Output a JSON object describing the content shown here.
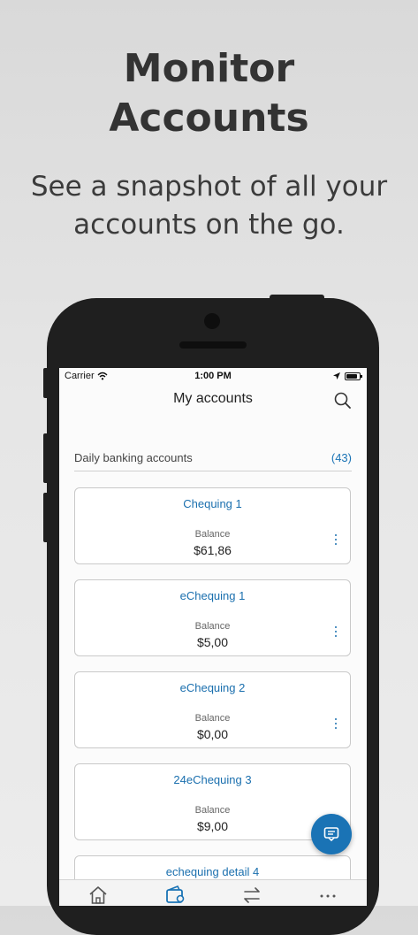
{
  "headline": {
    "title_line1": "Monitor",
    "title_line2": "Accounts",
    "subtitle_line1": "See a snapshot of all your",
    "subtitle_line2": "accounts on the go."
  },
  "status_bar": {
    "carrier": "Carrier",
    "time": "1:00 PM"
  },
  "nav": {
    "title": "My accounts",
    "search_icon": "search-icon"
  },
  "section": {
    "label": "Daily banking accounts",
    "count": "(43)"
  },
  "accounts": [
    {
      "name": "Chequing 1",
      "balance_label": "Balance",
      "balance": "$61,86"
    },
    {
      "name": "eChequing 1",
      "balance_label": "Balance",
      "balance": "$5,00"
    },
    {
      "name": "eChequing 2",
      "balance_label": "Balance",
      "balance": "$0,00"
    },
    {
      "name": "24eChequing 3",
      "balance_label": "Balance",
      "balance": "$9,00"
    },
    {
      "name": "echequing detail 4",
      "balance_label": "",
      "balance": ""
    }
  ],
  "tabbar": {
    "items": [
      "home-icon",
      "wallet-icon",
      "transfer-icon",
      "more-icon"
    ],
    "active": "wallet-icon"
  },
  "colors": {
    "accent": "#1a73b5",
    "link_text": "#1a6fae",
    "phone_body": "#1f1f1f"
  }
}
